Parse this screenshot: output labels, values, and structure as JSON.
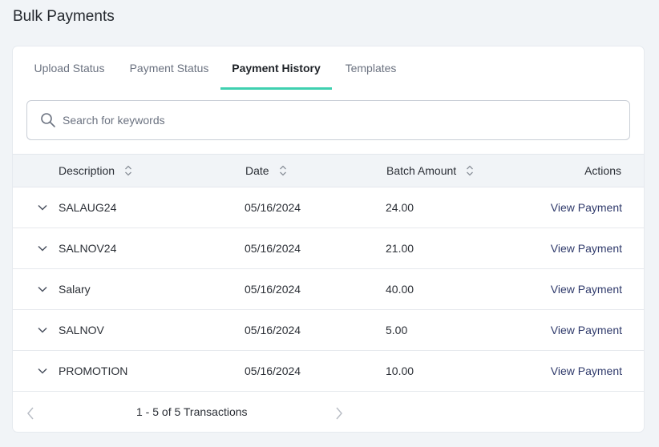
{
  "page": {
    "title": "Bulk Payments"
  },
  "tabs": [
    {
      "label": "Upload Status",
      "active": false
    },
    {
      "label": "Payment Status",
      "active": false
    },
    {
      "label": "Payment History",
      "active": true
    },
    {
      "label": "Templates",
      "active": false
    }
  ],
  "search": {
    "placeholder": "Search for keywords",
    "value": ""
  },
  "table": {
    "headers": {
      "description": "Description",
      "date": "Date",
      "batch_amount": "Batch Amount",
      "actions": "Actions"
    },
    "rows": [
      {
        "description": "SALAUG24",
        "date": "05/16/2024",
        "amount": "24.00",
        "action": "View Payment"
      },
      {
        "description": "SALNOV24",
        "date": "05/16/2024",
        "amount": "21.00",
        "action": "View Payment"
      },
      {
        "description": "Salary",
        "date": "05/16/2024",
        "amount": "40.00",
        "action": "View Payment"
      },
      {
        "description": "SALNOV",
        "date": "05/16/2024",
        "amount": "5.00",
        "action": "View Payment"
      },
      {
        "description": "PROMOTION",
        "date": "05/16/2024",
        "amount": "10.00",
        "action": "View Payment"
      }
    ]
  },
  "pagination": {
    "summary": "1 - 5 of 5 Transactions"
  },
  "icons": {
    "search": "search-icon",
    "sort": "sort-icon",
    "expand": "chevron-down-icon",
    "prev": "chevron-left-icon",
    "next": "chevron-right-icon"
  },
  "colors": {
    "accent": "#3fd0b0",
    "link": "#2f3a6b",
    "background": "#f1f4f7"
  }
}
